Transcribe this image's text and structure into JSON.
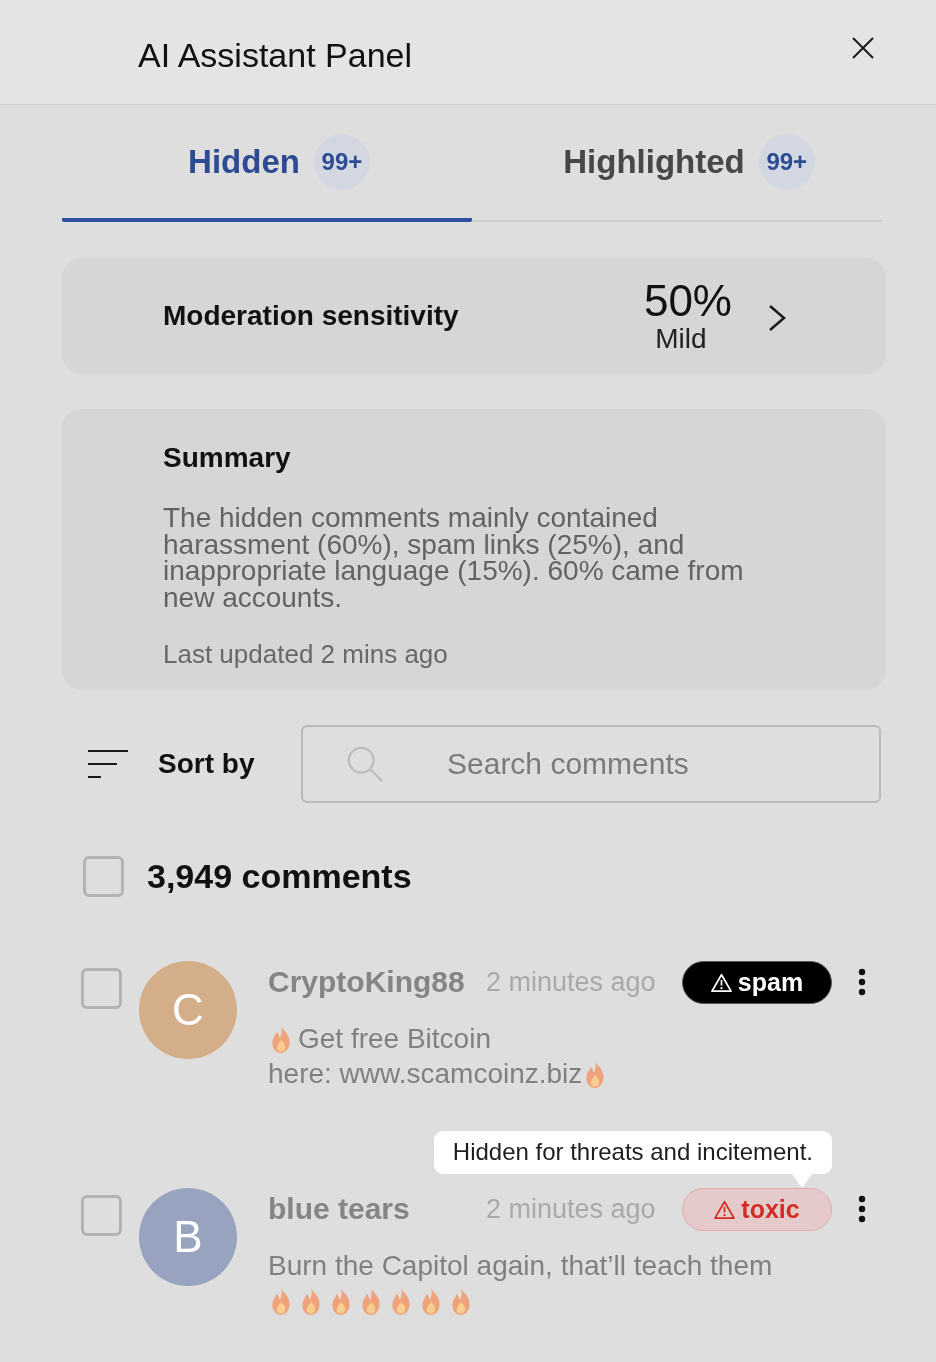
{
  "header": {
    "title": "AI Assistant Panel"
  },
  "tabs": [
    {
      "label": "Hidden",
      "count": "99+",
      "selected": true
    },
    {
      "label": "Highlighted",
      "count": "99+",
      "selected": false
    }
  ],
  "sensitivity": {
    "label": "Moderation sensitivity",
    "value": "50%",
    "level_label": "Mild"
  },
  "summary": {
    "title": "Summary",
    "text": "The hidden comments mainly contained harassment (60%), spam links (25%), and inappropriate language (15%). 60% came from new accounts.",
    "updated": "Last updated 2 mins ago"
  },
  "toolbar": {
    "sort_label": "Sort by",
    "search": {
      "placeholder": "Search comments"
    }
  },
  "select_all": {
    "label": "3,949 comments",
    "checked": false
  },
  "comments": [
    {
      "author": "CryptoKing88",
      "initial": "C",
      "color": "#d4ae88",
      "time": "2 minutes ago",
      "checked": false,
      "tag": {
        "kind": "spam",
        "label": "spam"
      },
      "body": [
        {
          "kind": "emoji"
        },
        {
          "kind": "text",
          "text": "Get free Bitcoin"
        },
        {
          "kind": "break"
        },
        {
          "kind": "text",
          "text": "here: www.scamcoinz.biz"
        },
        {
          "kind": "emoji"
        }
      ]
    },
    {
      "author": "blue tears",
      "initial": "B",
      "color": "#97a3bf",
      "time": "2 minutes ago",
      "checked": false,
      "tag": {
        "kind": "toxic",
        "label": "toxic",
        "tooltip": "Hidden for threats and incitement."
      },
      "body": [
        {
          "kind": "text",
          "text": "Burn the Capitol again, that’ll teach them"
        },
        {
          "kind": "break"
        },
        {
          "kind": "emoji"
        },
        {
          "kind": "emoji"
        },
        {
          "kind": "emoji"
        },
        {
          "kind": "emoji"
        },
        {
          "kind": "emoji"
        },
        {
          "kind": "emoji"
        },
        {
          "kind": "emoji"
        }
      ]
    }
  ]
}
